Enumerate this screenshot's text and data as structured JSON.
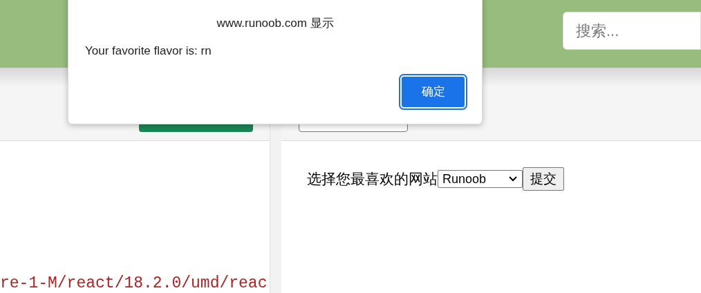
{
  "header": {
    "search": {
      "placeholder": "搜索..."
    }
  },
  "editor": {
    "code_line": "re-1-M/react/18.2.0/umd/reac"
  },
  "preview": {
    "label": "选择您最喜欢的网站",
    "select": {
      "value": "Runoob"
    },
    "submit": "提交"
  },
  "dialog": {
    "title": "www.runoob.com 显示",
    "message": "Your favorite flavor is: rn",
    "ok_button": "确定"
  }
}
